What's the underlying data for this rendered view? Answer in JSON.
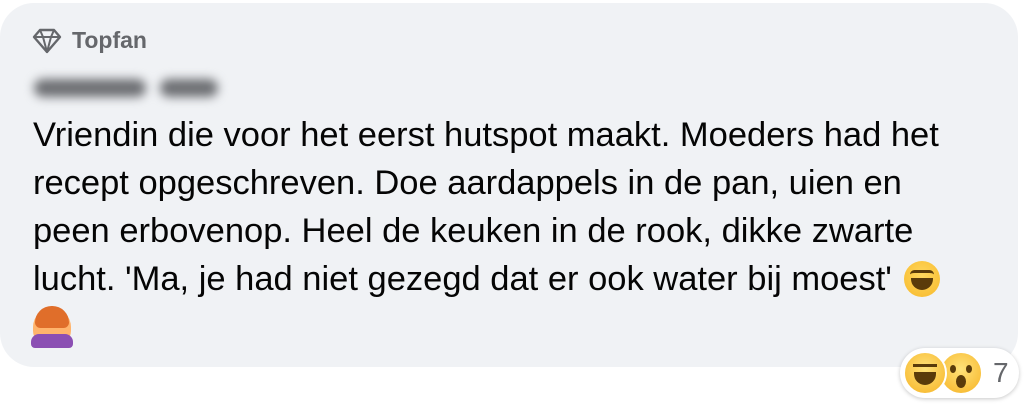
{
  "comment": {
    "badge_label": "Topfan",
    "badge_icon": "diamond-icon",
    "author_name_blurred": true,
    "text_lines": [
      "Vriendin die voor het eerst hutspot maakt. Moeders had het",
      "recept opgeschreven. Doe aardappels in de pan, uien en",
      "peen erbovenop. Heel de keuken in de rook, dikke zwarte",
      "lucht. 'Ma, je had niet gezegd dat er ook water bij moest'"
    ],
    "inline_emojis": [
      "laughing-face-emoji",
      "woman-facepalming-emoji"
    ]
  },
  "reactions": {
    "icons": [
      "haha-reaction-icon",
      "wow-reaction-icon"
    ],
    "count": "7"
  },
  "colors": {
    "bubble_bg": "#f0f2f5",
    "text": "#050505",
    "secondary_text": "#65676b"
  }
}
